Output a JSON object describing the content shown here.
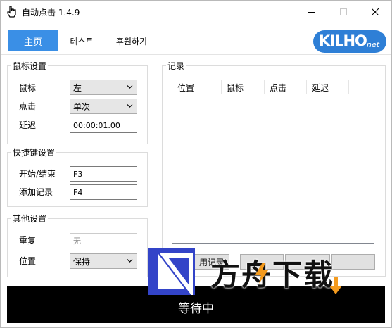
{
  "window": {
    "title": "自动点击 1.4.9"
  },
  "tabs": {
    "main": "主页",
    "test": "테스트",
    "donate": "후원하기"
  },
  "logo": {
    "text": "KILHO",
    "suffix": "net"
  },
  "mouse_settings": {
    "title": "鼠标设置",
    "mouse_label": "鼠标",
    "mouse_value": "左",
    "click_label": "点击",
    "click_value": "单次",
    "delay_label": "延迟",
    "delay_value": "00:00:01.00"
  },
  "hotkey_settings": {
    "title": "快捷键设置",
    "start_stop_label": "开始/结束",
    "start_stop_value": "F3",
    "add_record_label": "添加记录",
    "add_record_value": "F4"
  },
  "other_settings": {
    "title": "其他设置",
    "repeat_label": "重复",
    "repeat_value": "无",
    "position_label": "位置",
    "position_value": "保持"
  },
  "records": {
    "title": "记录",
    "columns": [
      "位置",
      "鼠标",
      "点击",
      "延迟"
    ],
    "buttons": [
      "用记录",
      "",
      "",
      ""
    ]
  },
  "status": {
    "text": "等待中"
  },
  "watermark": {
    "text": "方舟下载"
  },
  "colors": {
    "accent": "#3a8fe6",
    "logo": "#2e7fd6",
    "watermark_orange": "#f39a1e"
  }
}
